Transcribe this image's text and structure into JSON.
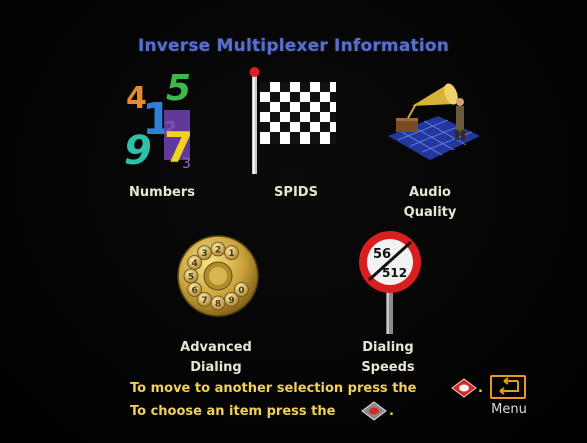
{
  "header": {
    "title": "Inverse Multiplexer Information"
  },
  "menu_items": [
    {
      "label": "Numbers",
      "icon": "numbers-icon"
    },
    {
      "label": "SPIDS",
      "icon": "checkered-flag-icon"
    },
    {
      "label": "Audio\nQuality",
      "icon": "gramophone-icon"
    },
    {
      "label": "Advanced\nDialing",
      "icon": "rotary-dial-icon"
    },
    {
      "label": "Dialing\nSpeeds",
      "icon": "speed-sign-icon"
    }
  ],
  "speed_sign": {
    "top": "56",
    "bottom": "512"
  },
  "rotary_digits": [
    "1",
    "2",
    "3",
    "4",
    "5",
    "6",
    "7",
    "8",
    "9",
    "0"
  ],
  "numbers_glyphs": [
    "4",
    "5",
    "1",
    "2",
    "9",
    "7",
    "3"
  ],
  "instructions": {
    "move": "To move to another selection press the",
    "choose": "To choose an item press the",
    "period": "."
  },
  "menu_button": {
    "label": "Menu",
    "icon": "back-arrow-icon"
  },
  "colors": {
    "title": "#5a6fc8",
    "label": "#e8e4d4",
    "instruction": "#f0cf5a",
    "menu_border": "#e59a1e"
  }
}
